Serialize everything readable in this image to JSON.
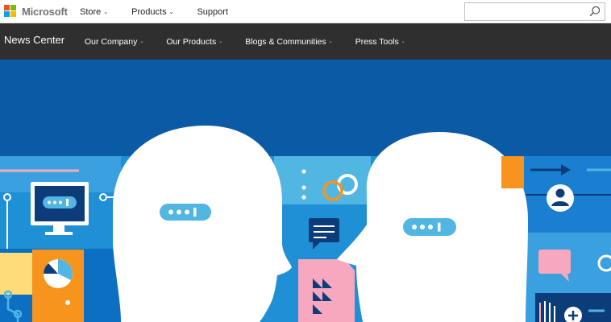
{
  "topbar": {
    "logo_text": "Microsoft",
    "logo_colors": [
      "#f25022",
      "#7fba00",
      "#00a4ef",
      "#ffb900"
    ],
    "nav": [
      {
        "label": "Store",
        "has_dropdown": true
      },
      {
        "label": "Products",
        "has_dropdown": true
      },
      {
        "label": "Support",
        "has_dropdown": false
      }
    ],
    "search": {
      "placeholder": "",
      "value": "",
      "icon": "search-icon"
    }
  },
  "newsbar": {
    "title": "News Center",
    "nav": [
      {
        "label": "Our Company",
        "has_dropdown": true
      },
      {
        "label": "Our Products",
        "has_dropdown": true
      },
      {
        "label": "Blogs & Communities",
        "has_dropdown": true
      },
      {
        "label": "Press Tools",
        "has_dropdown": true
      }
    ]
  },
  "hero": {
    "illustration": "two-heads-conversation",
    "colors": {
      "sky": "#0b5aa6",
      "band": "#1f8fd6",
      "light_band": "#51b6e2",
      "heads": "#ffffff",
      "accent_orange": "#f7941d",
      "accent_yellow": "#fedc7a",
      "accent_pink": "#f7a8bf",
      "dark_navy": "#0d3c7a"
    }
  },
  "chevron_glyph": "⌄"
}
